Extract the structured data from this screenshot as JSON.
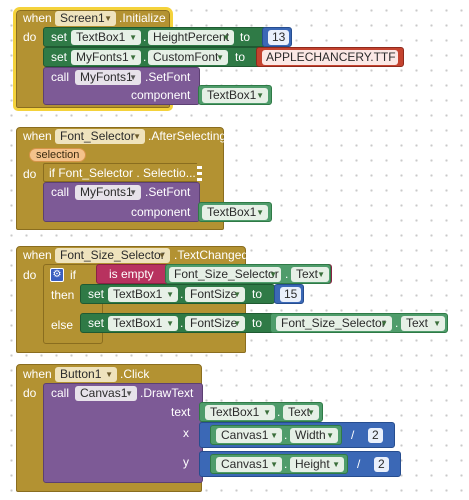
{
  "block1": {
    "when": "when",
    "component": "Screen1",
    "event": ".Initialize",
    "do": "do",
    "stmt1": {
      "set": "set",
      "component": "TextBox1",
      "property": "HeightPercent",
      "to": "to",
      "value": "13"
    },
    "stmt2": {
      "set": "set",
      "component": "MyFonts1",
      "property": "CustomFont",
      "to": "to",
      "value": "APPLECHANCERY.TTF"
    },
    "stmt3": {
      "call": "call",
      "component": "MyFonts1",
      "method": ".SetFont",
      "param_label": "component",
      "param_value": "TextBox1"
    }
  },
  "block2": {
    "when": "when",
    "component": "Font_Selector",
    "event": ".AfterSelecting",
    "param": "selection",
    "do": "do",
    "if_text": "if Font_Selector . Selectio...",
    "call": {
      "call": "call",
      "component": "MyFonts1",
      "method": ".SetFont",
      "param_label": "component",
      "param_value": "TextBox1"
    }
  },
  "block3": {
    "when": "when",
    "component": "Font_Size_Selector",
    "event": ".TextChanged",
    "do": "do",
    "if": "if",
    "is_empty": "is empty",
    "cond_component": "Font_Size_Selector",
    "cond_property": "Text",
    "then": "then",
    "then_set": {
      "set": "set",
      "component": "TextBox1",
      "property": "FontSize",
      "to": "to",
      "value": "15"
    },
    "else": "else",
    "else_set": {
      "set": "set",
      "component": "TextBox1",
      "property": "FontSize",
      "to": "to",
      "src_component": "Font_Size_Selector",
      "src_property": "Text"
    }
  },
  "block4": {
    "when": "when",
    "component": "Button1",
    "event": ".Click",
    "do": "do",
    "call": "call",
    "call_component": "Canvas1",
    "method": ".DrawText",
    "text_label": "text",
    "text_component": "TextBox1",
    "text_property": "Text",
    "x_label": "x",
    "x_component": "Canvas1",
    "x_property": "Width",
    "x_op": "/",
    "x_divisor": "2",
    "y_label": "y",
    "y_component": "Canvas1",
    "y_property": "Height",
    "y_op": "/",
    "y_divisor": "2"
  },
  "colors": {
    "event": "#b39232",
    "setter": "#2f7a46",
    "call": "#7d5a96",
    "math": "#3b68b6",
    "text": "#c4432f",
    "selection_highlight": "#f4d23b"
  }
}
